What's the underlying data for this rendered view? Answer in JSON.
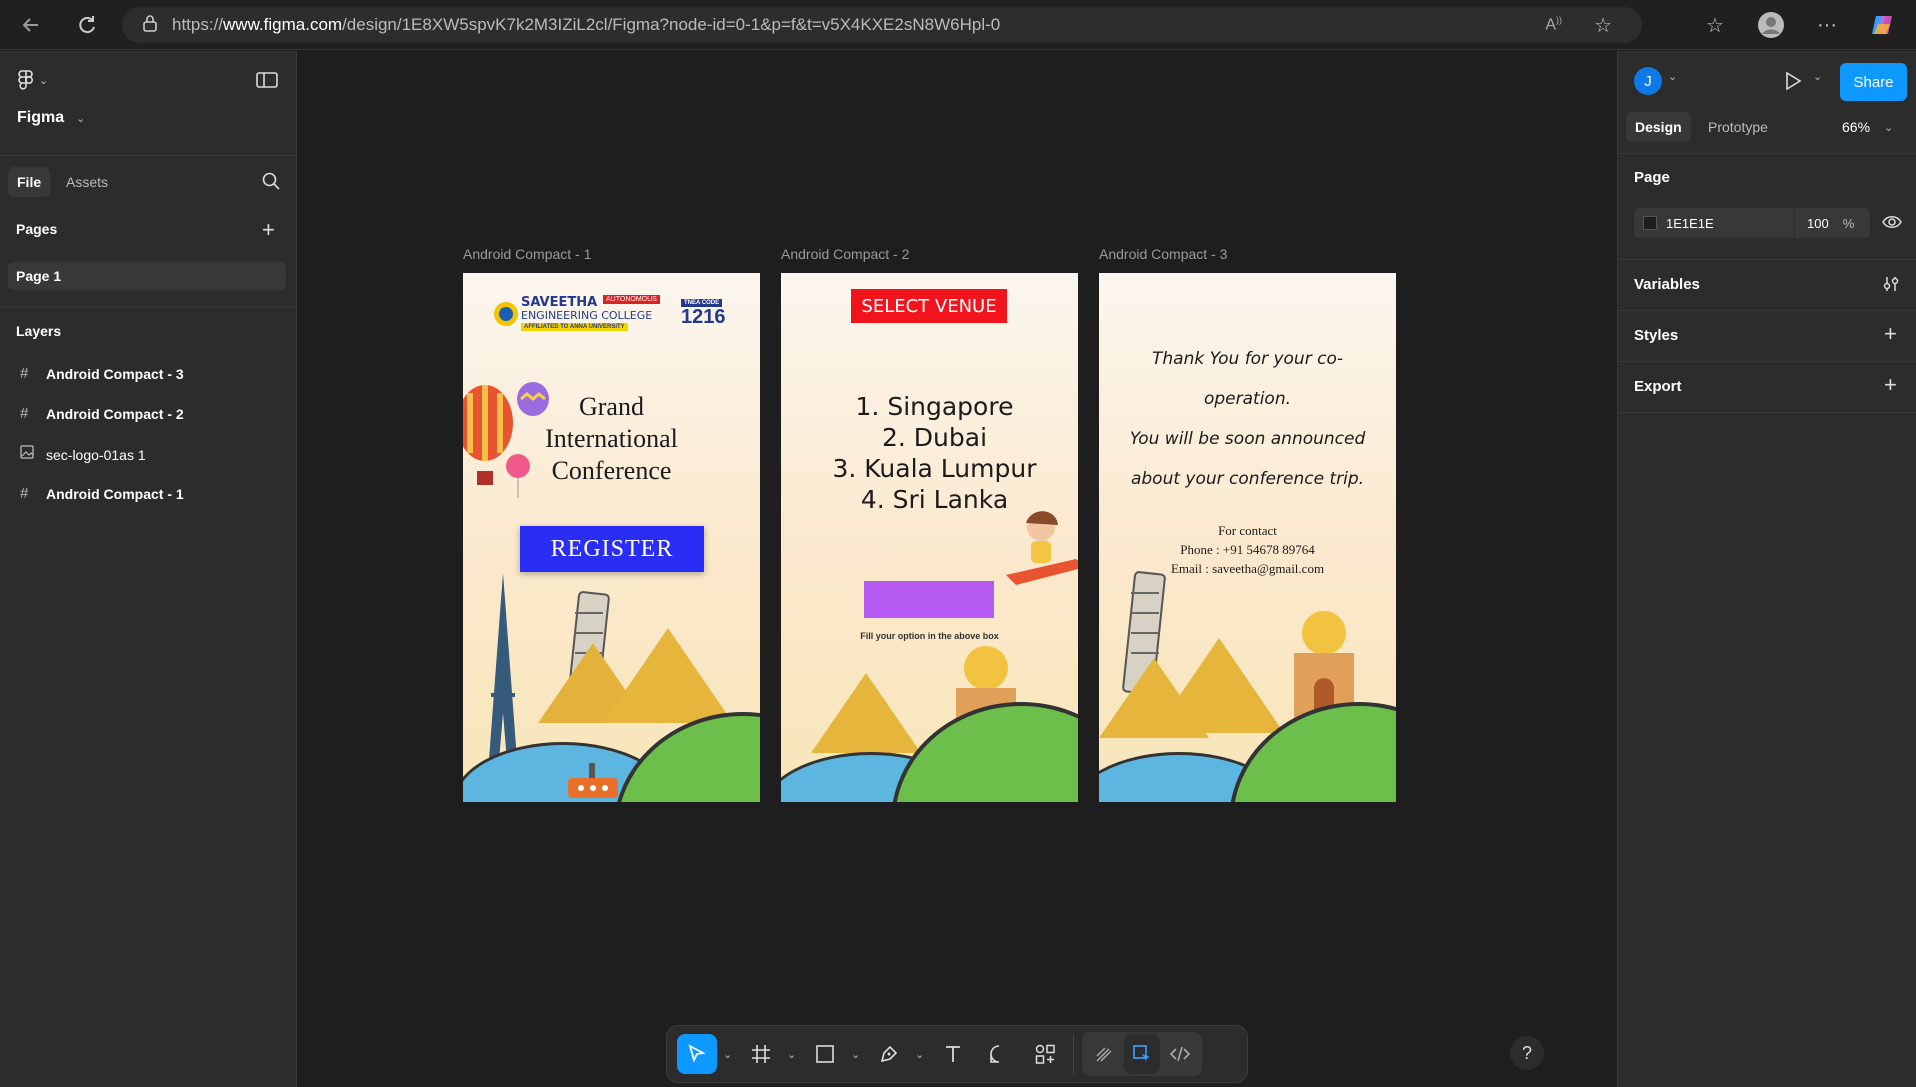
{
  "browser": {
    "url_prefix": "https://",
    "url_host": "www.figma.com",
    "url_path": "/design/1E8XW5spvK7k2M3IZiL2cl/Figma?node-id=0-1&p=f&t=v5X4KXE2sN8W6Hpl-0"
  },
  "left_panel": {
    "app_name": "Figma",
    "tabs": [
      "File",
      "Assets"
    ],
    "pages_heading": "Pages",
    "pages": [
      "Page 1"
    ],
    "layers_heading": "Layers",
    "layers": [
      {
        "name": "Android Compact - 3",
        "icon": "frame-icon"
      },
      {
        "name": "Android Compact - 2",
        "icon": "frame-icon"
      },
      {
        "name": "sec-logo-01as 1",
        "icon": "image-icon"
      },
      {
        "name": "Android Compact - 1",
        "icon": "frame-icon"
      }
    ]
  },
  "right_panel": {
    "avatar_letter": "J",
    "share_label": "Share",
    "tabs": [
      "Design",
      "Prototype"
    ],
    "zoom": "66%",
    "page_heading": "Page",
    "bg_color": "1E1E1E",
    "bg_opacity": "100",
    "bg_opacity_unit": "%",
    "sections": [
      "Variables",
      "Styles",
      "Export"
    ]
  },
  "frames": {
    "f1": {
      "label": "Android Compact - 1",
      "logo_name_1": "SAVEETHA",
      "logo_name_2": "ENGINEERING COLLEGE",
      "logo_badge": "AUTONOMOUS",
      "logo_affiliation": "AFFILIATED TO ANNA UNIVERSITY",
      "code_label": "TNEA CODE",
      "code_value": "1216",
      "title_line1": "Grand",
      "title_line2": "International",
      "title_line3": "Conference",
      "register_label": "REGISTER"
    },
    "f2": {
      "label": "Android Compact - 2",
      "header": "SELECT VENUE",
      "venues": [
        "1. Singapore",
        "2. Dubai",
        "3. Kuala Lumpur",
        "4. Sri Lanka"
      ],
      "hint": "Fill your option in the above box"
    },
    "f3": {
      "label": "Android Compact - 3",
      "line1": "Thank You for your co-",
      "line2": "operation.",
      "line3": "You will be soon announced",
      "line4": "about your conference trip.",
      "contact_heading": "For contact",
      "phone": "Phone : +91 54678 89764",
      "email": "Email : saveetha@gmail.com"
    }
  },
  "help_label": "?",
  "colors": {
    "accent": "#0d99ff",
    "register_bg": "#2a2ef5",
    "venue_header_bg": "#f2141c",
    "option_box": "#b45af2"
  }
}
